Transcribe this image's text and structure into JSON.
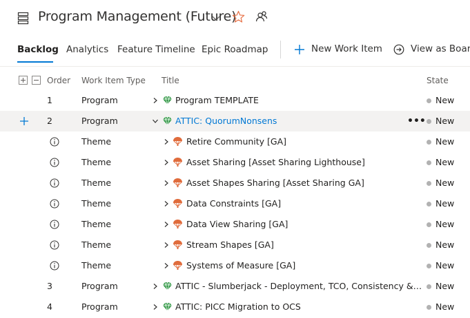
{
  "header": {
    "title": "Program Management (Future)",
    "icons": [
      "board-icon",
      "chevron-down-icon",
      "star-icon",
      "people-icon"
    ],
    "star_color": "#e8744a"
  },
  "tabs": [
    {
      "label": "Backlog",
      "active": true
    },
    {
      "label": "Analytics",
      "active": false
    },
    {
      "label": "Feature Timeline",
      "active": false
    },
    {
      "label": "Epic Roadmap",
      "active": false
    }
  ],
  "toolbar": {
    "new_work_item": "New Work Item",
    "view_as_board": "View as Board"
  },
  "columns": {
    "order": "Order",
    "work_item_type": "Work Item Type",
    "title": "Title",
    "state": "State"
  },
  "rows": [
    {
      "order": "1",
      "type": "Program",
      "title": "Program TEMPLATE",
      "state": "New",
      "icon": "gem-icon"
    },
    {
      "order": "2",
      "type": "Program",
      "title": "ATTIC: QuorumNonsens",
      "state": "New",
      "icon": "gem-icon",
      "expanded": true,
      "selected": true
    },
    {
      "order": "",
      "type": "Theme",
      "title": "Retire Community [GA]",
      "state": "New",
      "icon": "parachute-icon"
    },
    {
      "order": "",
      "type": "Theme",
      "title": "Asset Sharing [Asset Sharing Lighthouse]",
      "state": "New",
      "icon": "parachute-icon"
    },
    {
      "order": "",
      "type": "Theme",
      "title": "Asset Shapes Sharing [Asset Sharing GA]",
      "state": "New",
      "icon": "parachute-icon"
    },
    {
      "order": "",
      "type": "Theme",
      "title": "Data Constraints [GA]",
      "state": "New",
      "icon": "parachute-icon"
    },
    {
      "order": "",
      "type": "Theme",
      "title": "Data View Sharing [GA]",
      "state": "New",
      "icon": "parachute-icon"
    },
    {
      "order": "",
      "type": "Theme",
      "title": "Stream Shapes [GA]",
      "state": "New",
      "icon": "parachute-icon"
    },
    {
      "order": "",
      "type": "Theme",
      "title": "Systems of Measure [GA]",
      "state": "New",
      "icon": "parachute-icon"
    },
    {
      "order": "3",
      "type": "Program",
      "title": "ATTIC - Slumberjack - Deployment, TCO, Consistency & Gov...",
      "state": "New",
      "icon": "gem-icon"
    },
    {
      "order": "4",
      "type": "Program",
      "title": "ATTIC: PICC Migration to OCS",
      "state": "New",
      "icon": "gem-icon"
    }
  ],
  "colors": {
    "accent": "#0078d4",
    "program_icon": "#339947",
    "theme_icon": "#e06c3c",
    "state_new": "#b2b2b2"
  }
}
